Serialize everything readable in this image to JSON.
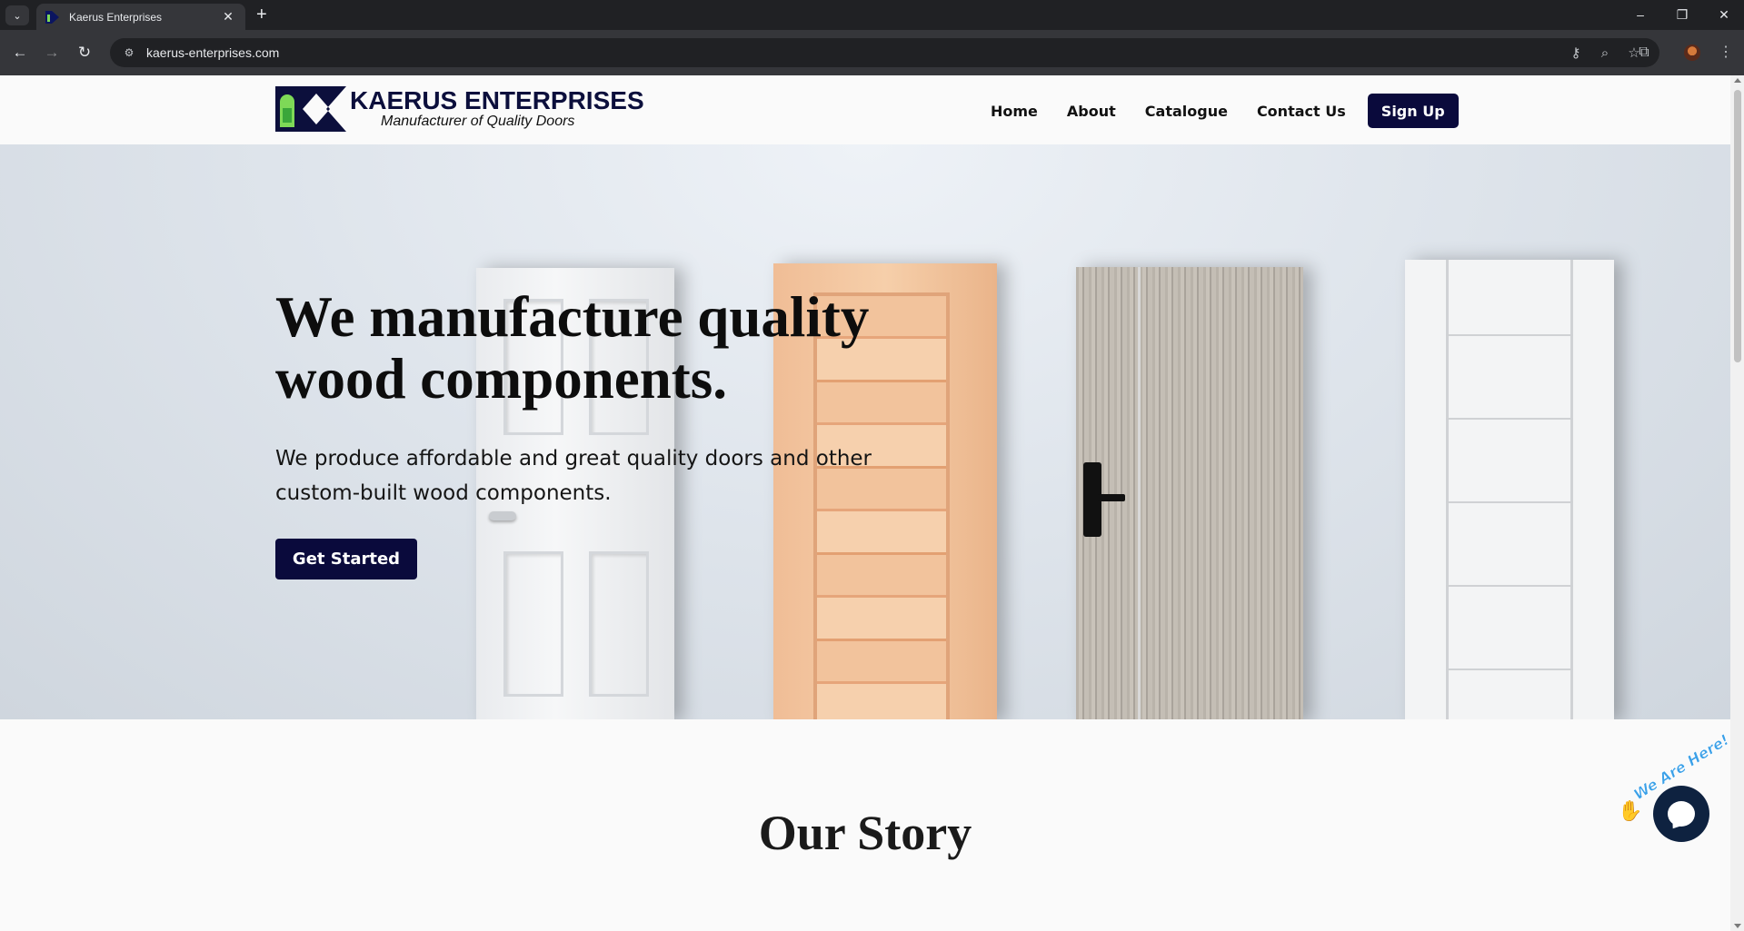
{
  "browser": {
    "tab_title": "Kaerus Enterprises",
    "url": "kaerus-enterprises.com"
  },
  "site": {
    "logo_name": "KAERUS ENTERPRISES",
    "logo_tagline": "Manufacturer of Quality Doors",
    "nav": {
      "home": "Home",
      "about": "About",
      "catalogue": "Catalogue",
      "contact": "Contact Us",
      "signup": "Sign Up"
    }
  },
  "hero": {
    "title_line1": "We manufacture quality",
    "title_line2": "wood components.",
    "subtitle_line1": "We produce affordable and great quality doors and other",
    "subtitle_line2": "custom-built wood components.",
    "cta": "Get Started"
  },
  "story": {
    "title": "Our Story"
  },
  "chat_widget": {
    "label": "We Are Here!"
  },
  "colors": {
    "brand_navy": "#0a0a3c",
    "brand_green": "#7ed957"
  }
}
